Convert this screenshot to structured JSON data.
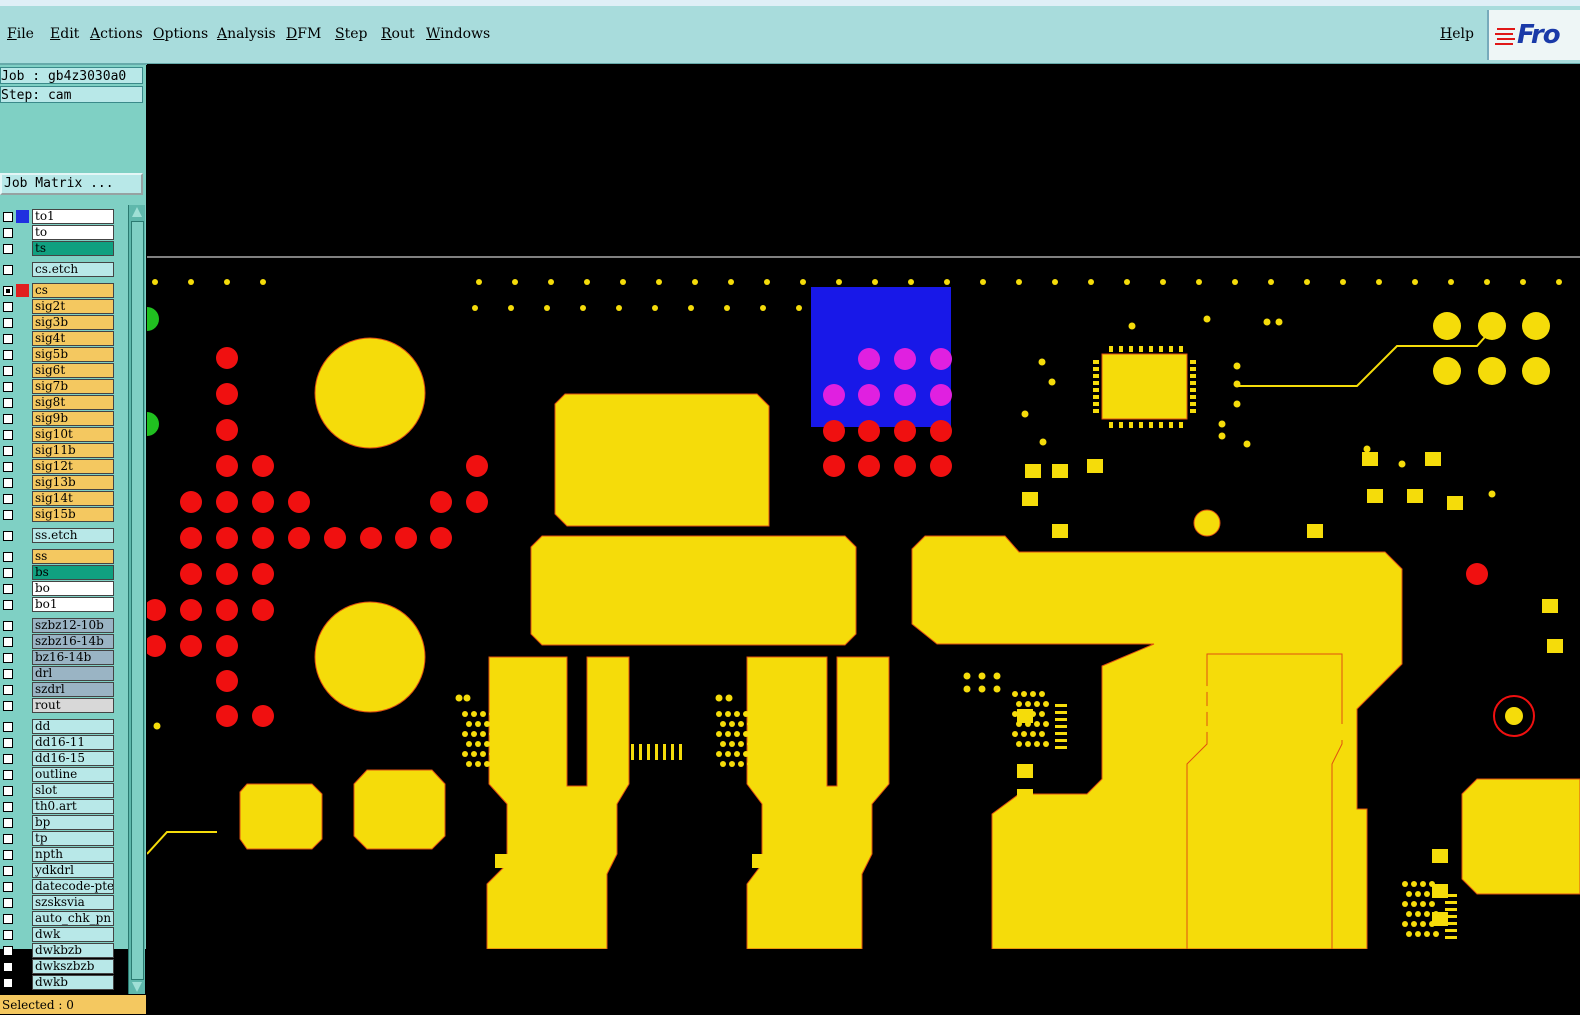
{
  "menubar": {
    "items": [
      "File",
      "Edit",
      "Actions",
      "Options",
      "Analysis",
      "DFM",
      "Step",
      "Rout",
      "Windows"
    ],
    "help": "Help",
    "logo_text": "Fro"
  },
  "job": {
    "job_label": "Job  : gb4z3030a0",
    "step_label": "Step: cam",
    "matrix_button": "Job Matrix ..."
  },
  "layers": [
    {
      "name": "to1",
      "color": "#ffffff",
      "swatch": "#2030e0",
      "checked": false
    },
    {
      "name": "to",
      "color": "#ffffff",
      "swatch": "",
      "checked": false
    },
    {
      "name": "ts",
      "color": "#10a080",
      "swatch": "",
      "checked": false
    },
    {
      "name": "cs.etch",
      "color": "#b8e8e8",
      "swatch": "",
      "checked": false,
      "gap": true
    },
    {
      "name": "cs",
      "color": "#f4c860",
      "swatch": "#e02020",
      "checked": true,
      "gap": true
    },
    {
      "name": "sig2t",
      "color": "#f4c860",
      "swatch": "",
      "checked": false
    },
    {
      "name": "sig3b",
      "color": "#f4c860",
      "swatch": "",
      "checked": false
    },
    {
      "name": "sig4t",
      "color": "#f4c860",
      "swatch": "",
      "checked": false
    },
    {
      "name": "sig5b",
      "color": "#f4c860",
      "swatch": "",
      "checked": false
    },
    {
      "name": "sig6t",
      "color": "#f4c860",
      "swatch": "",
      "checked": false
    },
    {
      "name": "sig7b",
      "color": "#f4c860",
      "swatch": "",
      "checked": false
    },
    {
      "name": "sig8t",
      "color": "#f4c860",
      "swatch": "",
      "checked": false
    },
    {
      "name": "sig9b",
      "color": "#f4c860",
      "swatch": "",
      "checked": false
    },
    {
      "name": "sig10t",
      "color": "#f4c860",
      "swatch": "",
      "checked": false
    },
    {
      "name": "sig11b",
      "color": "#f4c860",
      "swatch": "",
      "checked": false
    },
    {
      "name": "sig12t",
      "color": "#f4c860",
      "swatch": "",
      "checked": false
    },
    {
      "name": "sig13b",
      "color": "#f4c860",
      "swatch": "",
      "checked": false
    },
    {
      "name": "sig14t",
      "color": "#f4c860",
      "swatch": "",
      "checked": false
    },
    {
      "name": "sig15b",
      "color": "#f4c860",
      "swatch": "",
      "checked": false
    },
    {
      "name": "ss.etch",
      "color": "#b8e8e8",
      "swatch": "",
      "checked": false,
      "gap": true
    },
    {
      "name": "ss",
      "color": "#f4c860",
      "swatch": "",
      "checked": false,
      "gap": true
    },
    {
      "name": "bs",
      "color": "#10a080",
      "swatch": "",
      "checked": false
    },
    {
      "name": "bo",
      "color": "#ffffff",
      "swatch": "",
      "checked": false
    },
    {
      "name": "bo1",
      "color": "#ffffff",
      "swatch": "",
      "checked": false
    },
    {
      "name": "szbz12-10b",
      "color": "#9ab4c4",
      "swatch": "",
      "checked": false,
      "gap": true
    },
    {
      "name": "szbz16-14b",
      "color": "#9ab4c4",
      "swatch": "",
      "checked": false
    },
    {
      "name": "bz16-14b",
      "color": "#9ab4c4",
      "swatch": "",
      "checked": false
    },
    {
      "name": "drl",
      "color": "#9ab4c4",
      "swatch": "",
      "checked": false
    },
    {
      "name": "szdrl",
      "color": "#9ab4c4",
      "swatch": "",
      "checked": false
    },
    {
      "name": "rout",
      "color": "#d8d8d8",
      "swatch": "",
      "checked": false
    },
    {
      "name": "dd",
      "color": "#b8e8e8",
      "swatch": "",
      "checked": false,
      "gap": true
    },
    {
      "name": "dd16-11",
      "color": "#b8e8e8",
      "swatch": "",
      "checked": false
    },
    {
      "name": "dd16-15",
      "color": "#b8e8e8",
      "swatch": "",
      "checked": false
    },
    {
      "name": "outline",
      "color": "#b8e8e8",
      "swatch": "",
      "checked": false
    },
    {
      "name": "slot",
      "color": "#b8e8e8",
      "swatch": "",
      "checked": false
    },
    {
      "name": "th0.art",
      "color": "#b8e8e8",
      "swatch": "",
      "checked": false
    },
    {
      "name": "bp",
      "color": "#b8e8e8",
      "swatch": "",
      "checked": false
    },
    {
      "name": "tp",
      "color": "#b8e8e8",
      "swatch": "",
      "checked": false
    },
    {
      "name": "npth",
      "color": "#b8e8e8",
      "swatch": "",
      "checked": false
    },
    {
      "name": "ydkdrl",
      "color": "#b8e8e8",
      "swatch": "",
      "checked": false
    },
    {
      "name": "datecode-pte",
      "color": "#b8e8e8",
      "swatch": "",
      "checked": false
    },
    {
      "name": "szsksvia",
      "color": "#b8e8e8",
      "swatch": "",
      "checked": false
    },
    {
      "name": "auto_chk_pn",
      "color": "#b8e8e8",
      "swatch": "",
      "checked": false
    },
    {
      "name": "dwk",
      "color": "#b8e8e8",
      "swatch": "",
      "checked": false
    },
    {
      "name": "dwkbzb",
      "color": "#b8e8e8",
      "swatch": "",
      "checked": false
    },
    {
      "name": "dwkszbzb",
      "color": "#b8e8e8",
      "swatch": "",
      "checked": false
    },
    {
      "name": "dwkb",
      "color": "#b8e8e8",
      "swatch": "",
      "checked": false
    }
  ],
  "status": {
    "selected": "Selected : 0"
  },
  "colors": {
    "copper": "#f5dc0a",
    "pad_red": "#f01010",
    "pad_magenta": "#e020e0",
    "highlight_blue": "#1818e8"
  }
}
